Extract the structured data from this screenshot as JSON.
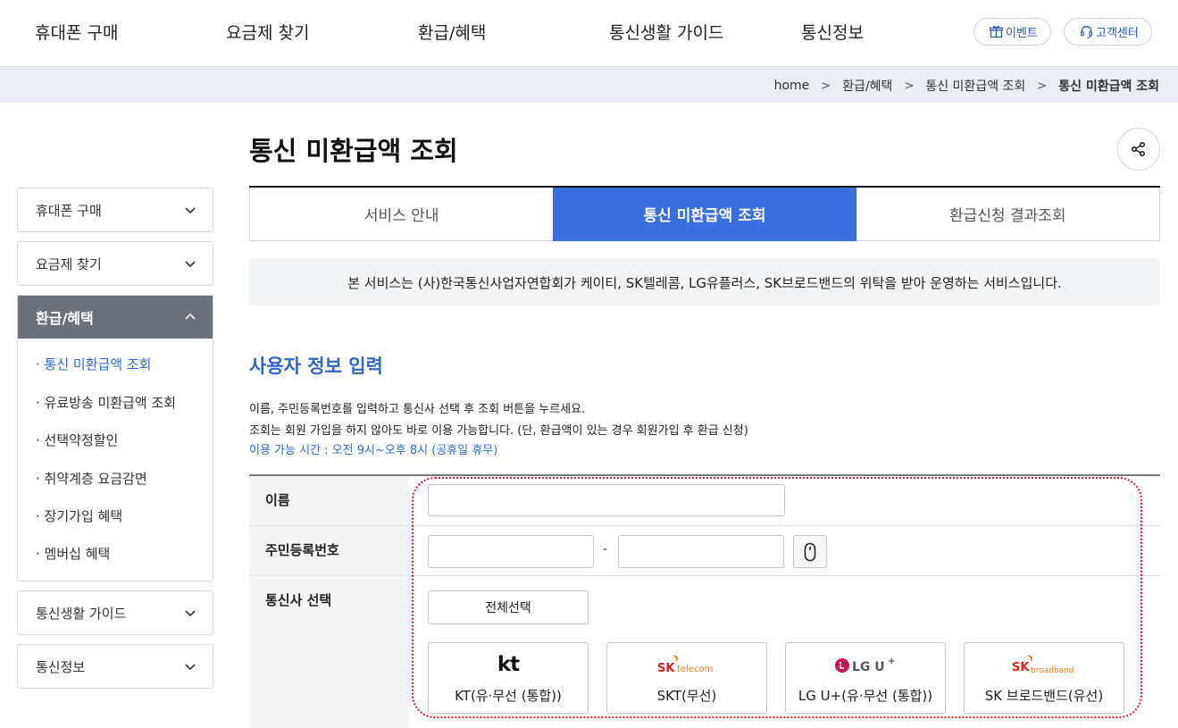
{
  "topnav": {
    "items": [
      "휴대폰 구매",
      "요금제 찾기",
      "환급/혜택",
      "통신생활 가이드",
      "통신정보"
    ],
    "event_label": "이벤트",
    "support_label": "고객센터"
  },
  "breadcrumb": [
    "home",
    "환급/혜택",
    "통신 미환급액 조회",
    "통신 미환급액 조회"
  ],
  "page_title": "통신 미환급액 조회",
  "sidebar": {
    "menus": [
      "휴대폰 구매",
      "요금제 찾기",
      "환급/혜택",
      "통신생활 가이드",
      "통신정보"
    ],
    "sub_items": [
      "통신 미환급액 조회",
      "유료방송 미환급액 조회",
      "선택약정할인",
      "취약계층 요금감면",
      "장기가입 혜택",
      "멤버십 혜택"
    ]
  },
  "tabs": [
    "서비스 안내",
    "통신 미환급액 조회",
    "환급신청 결과조회"
  ],
  "notice": "본 서비스는 (사)한국통신사업자연합회가 케이티, SK텔레콤, LG유플러스, SK브로드밴드의 위탁을 받아 운영하는 서비스입니다.",
  "section": {
    "title": "사용자 정보 입력",
    "desc1": "이름, 주민등록번호를 입력하고 통신사 선택 후 조회 버튼을 누르세요.",
    "desc2": "조회는 회원 가입을 하지 않아도 바로 이용 가능합니다. (단, 환급액이 있는 경우 회원가입 후 환급 신청)",
    "hours": "이용 가능 시간 : 오전 9시~오후 8시 (공휴일 휴무)"
  },
  "form": {
    "name_label": "이름",
    "rrn_label": "주민등록번호",
    "rrn_sep": "-",
    "carrier_label": "통신사 선택",
    "select_all": "전체선택",
    "carriers": [
      {
        "logo": "kt",
        "label": "KT(유·무선 (통합))"
      },
      {
        "logo": "SK telecom",
        "label": "SKT(무선)"
      },
      {
        "logo": "LG U+",
        "label": "LG U+(유·무선 (통합))"
      },
      {
        "logo": "SK broadband",
        "label": "SK 브로드밴드(유선)"
      }
    ]
  },
  "colors": {
    "accent": "#3a6fe0",
    "title_blue": "#2e66c9",
    "highlight": "#e02020"
  }
}
